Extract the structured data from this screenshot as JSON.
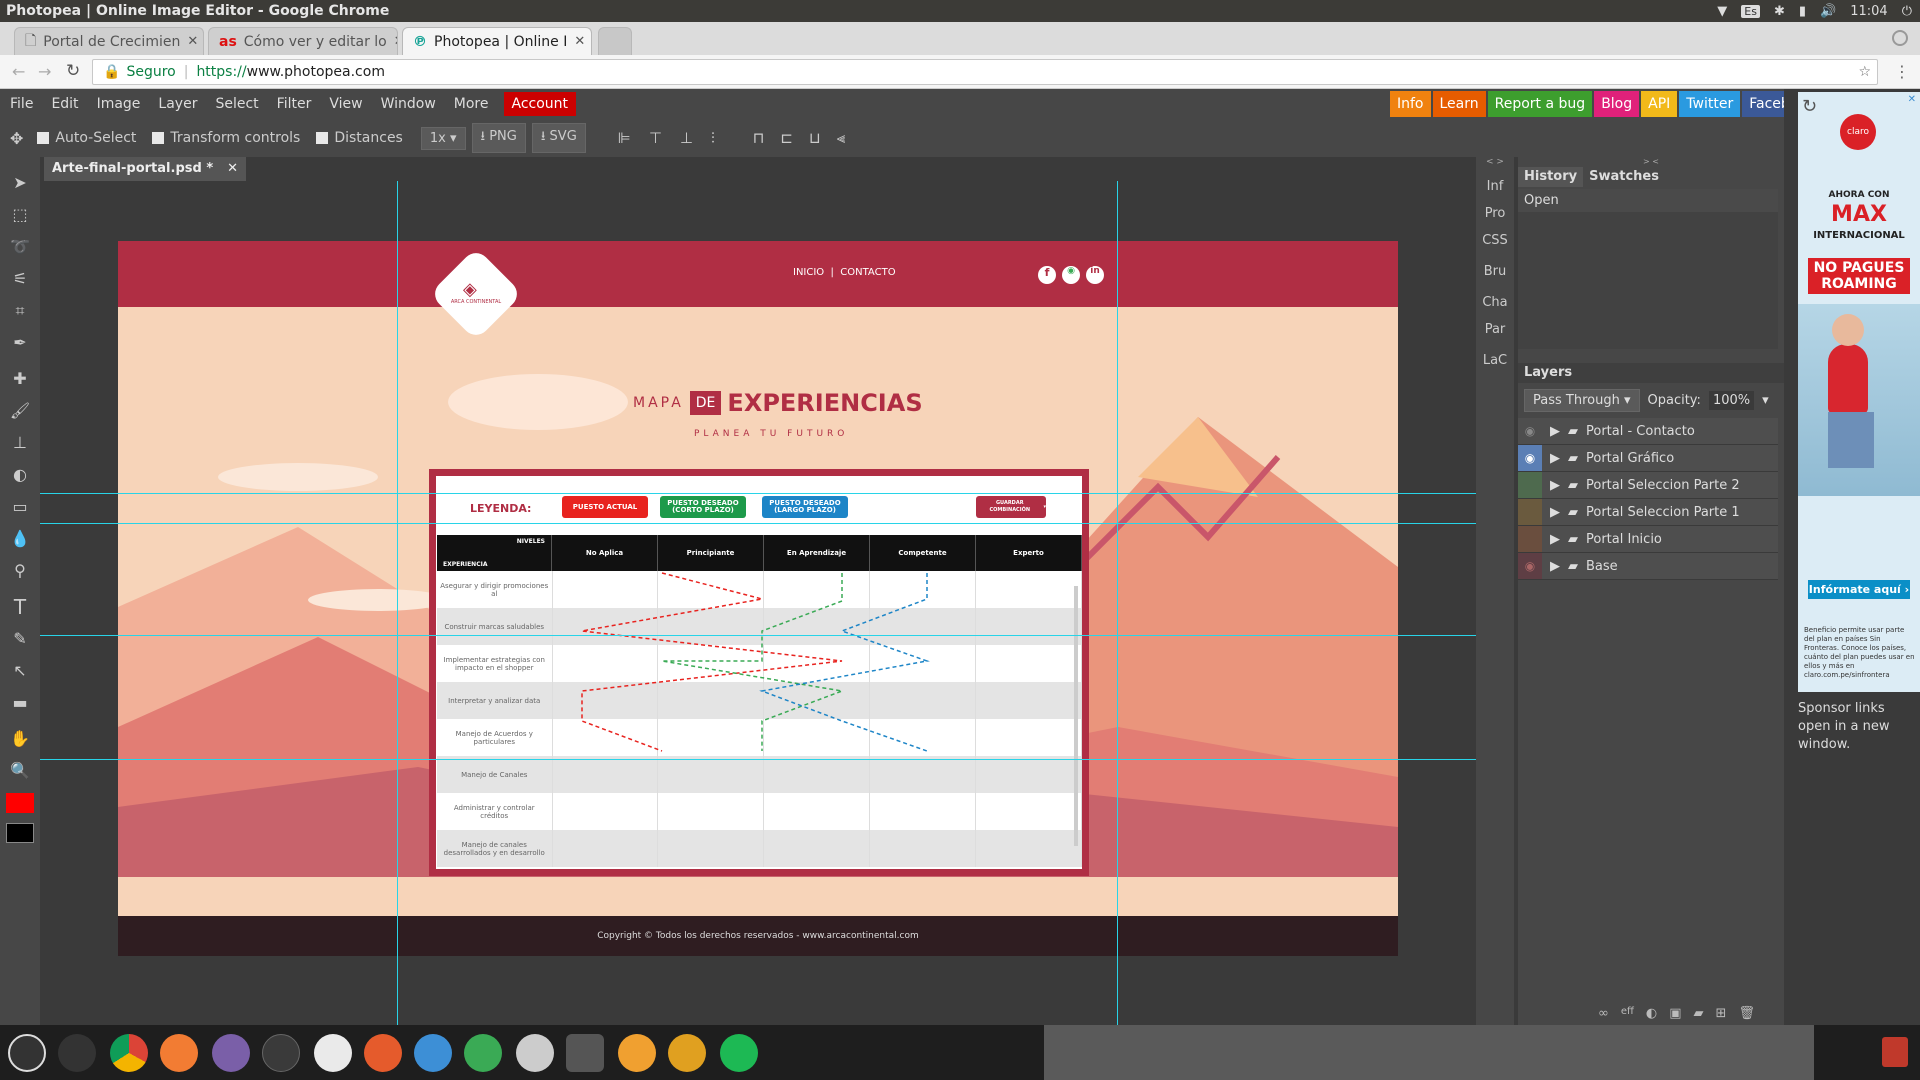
{
  "system": {
    "window_title": "Photopea | Online Image Editor - Google Chrome",
    "keyboard": "Es",
    "time": "11:04"
  },
  "tabs": [
    {
      "label": "Portal de Crecimien",
      "icon": "doc"
    },
    {
      "label": "Cómo ver y editar lo",
      "icon": "as"
    },
    {
      "label": "Photopea | Online I",
      "icon": "p"
    }
  ],
  "address": {
    "secure": "Seguro",
    "url": "https://www.photopea.com",
    "protocol": "https://",
    "domain": "www.photopea.com"
  },
  "menu": {
    "items": [
      "File",
      "Edit",
      "Image",
      "Layer",
      "Select",
      "Filter",
      "View",
      "Window",
      "More"
    ],
    "account": "Account"
  },
  "right_buttons": [
    {
      "label": "Info",
      "color": "#f0820f"
    },
    {
      "label": "Learn",
      "color": "#e65c00"
    },
    {
      "label": "Report a bug",
      "color": "#3d9e2e"
    },
    {
      "label": "Blog",
      "color": "#e0217a"
    },
    {
      "label": "API",
      "color": "#f2b91a"
    },
    {
      "label": "Twitter",
      "color": "#2a9ae0"
    },
    {
      "label": "Facebook",
      "color": "#3b5998"
    }
  ],
  "options": {
    "auto_select": "Auto-Select",
    "transform": "Transform controls",
    "distances": "Distances",
    "zoom": "1x",
    "png": "PNG",
    "svg": "SVG"
  },
  "document": {
    "tab": "Arte-final-portal.psd *"
  },
  "side_tabs": [
    "Inf",
    "Pro",
    "CSS",
    "Bru",
    "Cha",
    "Par",
    "LaC"
  ],
  "history": {
    "tabs": [
      "History",
      "Swatches"
    ],
    "items": [
      "Open"
    ]
  },
  "layers": {
    "title": "Layers",
    "blend": "Pass Through",
    "opacity_label": "Opacity:",
    "opacity": "100%",
    "items": [
      "Portal - Contacto",
      "Portal Gráfico",
      "Portal Seleccion Parte 2",
      "Portal Seleccion Parte 1",
      "Portal Inicio",
      "Base"
    ]
  },
  "design": {
    "nav": "INICIO  |  CONTACTO",
    "title_a": "MAPA",
    "title_de": "DE",
    "title_b": "EXPERIENCIAS",
    "subtitle": "PLANEA TU FUTURO",
    "logo_text": "ARCA CONTINENTAL",
    "legend_label": "LEYENDA:",
    "legend": [
      {
        "label": "PUESTO ACTUAL",
        "color": "#e8231f"
      },
      {
        "label": "PUESTO DESEADO (CORTO PLAZO)",
        "color": "#1d9a4a"
      },
      {
        "label": "PUESTO DESEADO (LARGO PLAZO)",
        "color": "#1d85c7"
      }
    ],
    "save_btn": "GUARDAR COMBINACIÓN",
    "corner_top": "NIVELES",
    "corner_bottom": "EXPERIENCIA",
    "levels": [
      "No Aplica",
      "Principiante",
      "En Aprendizaje",
      "Competente",
      "Experto"
    ],
    "rows": [
      "Asegurar y dirigir promociones al",
      "Construir marcas saludables",
      "Implementar estrategias con impacto en el shopper",
      "Interpretar y analizar data",
      "Manejo de Acuerdos y particulares",
      "Manejo de Canales",
      "Administrar y controlar créditos",
      "Manejo de canales desarrollados y en desarrollo"
    ],
    "footer": "Copyright © Todos los derechos reservados - www.arcacontinental.com"
  },
  "ad": {
    "headline": "AHORA CON",
    "brand": "MAX",
    "intl": "INTERNACIONAL",
    "promo": "NO PAGUES ROAMING",
    "cta": "Infórmate aquí",
    "fine": "Beneficio permite usar parte del plan en países Sin Fronteras. Conoce los países, cuánto del plan puedes usar en ellos y más en claro.com.pe/sinfrontera",
    "sponsor": "Sponsor links open in a new window."
  }
}
